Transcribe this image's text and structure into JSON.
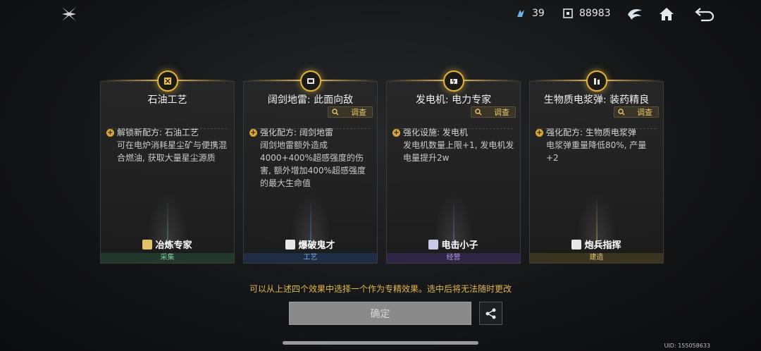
{
  "topbar": {
    "resource1": {
      "icon": "shard-icon",
      "value": "39"
    },
    "resource2": {
      "icon": "chip-icon",
      "value": "88983"
    }
  },
  "cards": [
    {
      "title": "石油工艺",
      "show_inspect": false,
      "inspect": "",
      "desc_head": "解锁新配方: 石油工艺",
      "desc_body": "可在电炉消耗星尘矿与便携混合燃油, 获取大量星尘源质",
      "role": "冶炼专家",
      "category": "采集",
      "category_color": "#22382c",
      "category_text_color": "#7fc89a",
      "beam_color": "#4fae7a"
    },
    {
      "title": "阔剑地雷: 此面向敌",
      "show_inspect": true,
      "inspect": "调查",
      "desc_head": "强化配方: 阔剑地雷",
      "desc_body": "阔剑地雷额外造成4000+400%超感强度的伤害, 额外增加400%超感强度的最大生命值",
      "role": "爆破鬼才",
      "category": "工艺",
      "category_color": "#1e2c44",
      "category_text_color": "#7fa8e8",
      "beam_color": "#4f8fcf"
    },
    {
      "title": "发电机: 电力专家",
      "show_inspect": true,
      "inspect": "调查",
      "desc_head": "强化设施: 发电机",
      "desc_body": "发电机数量上限+1, 发电机发电量提升2w",
      "role": "电击小子",
      "category": "经营",
      "category_color": "#2e2644",
      "category_text_color": "#b49ae6",
      "beam_color": "#8f6fd6"
    },
    {
      "title": "生物质电浆弹: 装药精良",
      "show_inspect": true,
      "inspect": "调查",
      "desc_head": "强化配方: 生物质电浆弹",
      "desc_body": "电浆弹重量降低80%, 产量+2",
      "role": "炮兵指挥",
      "category": "建造",
      "category_color": "#3a3520",
      "category_text_color": "#e0c56f",
      "beam_color": "#d1b45a"
    }
  ],
  "hint": "可以从上述四个效果中选择一个作为专精效果。选中后将无法随时更改",
  "confirm_label": "确定",
  "uid": "UID: 155058633",
  "colors": {
    "accent": "#e3b53a",
    "hint": "#e0b64b"
  }
}
